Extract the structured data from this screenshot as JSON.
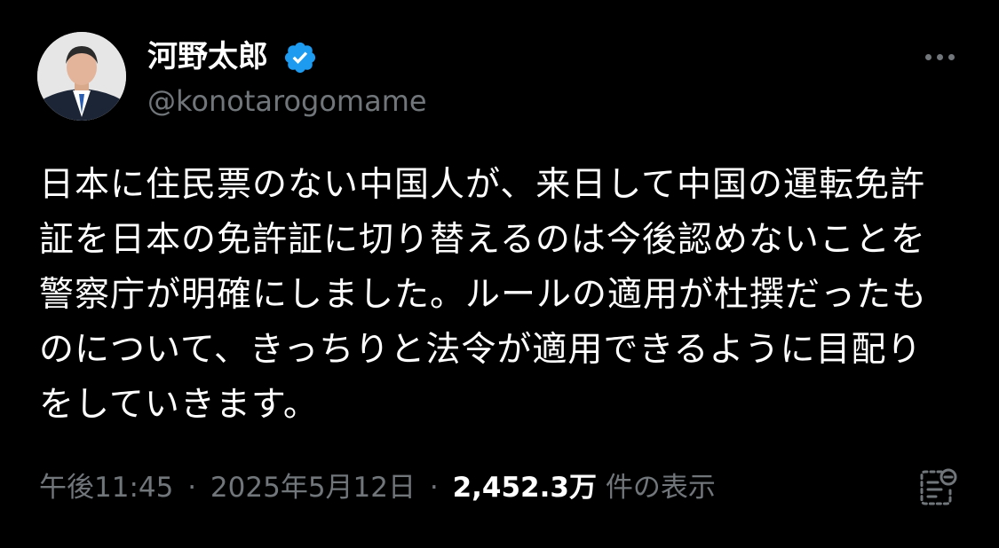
{
  "profile": {
    "display_name": "河野太郎",
    "handle": "@konotarogomame",
    "verified": true,
    "verified_color": "#1d9bf0"
  },
  "post": {
    "lines": [
      "日本に住民票のない中国人が、来日して中国の運転免許",
      "証を日本の免許証に切り替えるのは今後認めないことを",
      "警察庁が明確にしました。ルールの適用が杜撰だったも",
      "のについて、きっちりと法令が適用できるように目配り",
      "をしていきます。"
    ]
  },
  "meta": {
    "time": "午後11:45",
    "separator": "·",
    "date": "2025年5月12日",
    "views_count": "2,452.3万",
    "views_suffix": "件の表示"
  },
  "icons": {
    "more": "more-horizontal-icon",
    "analytics": "post-analytics-icon",
    "verified": "verified-badge-icon"
  }
}
